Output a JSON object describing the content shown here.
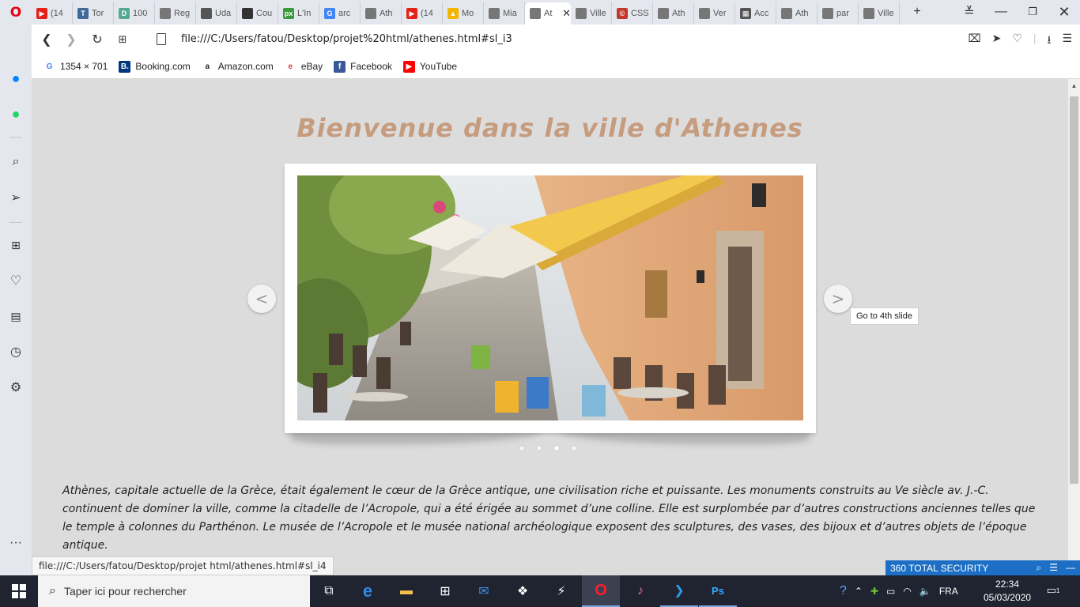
{
  "browser": {
    "tabs": [
      {
        "label": "(14",
        "favicon_color": "#e62117",
        "glyph": "▶"
      },
      {
        "label": "Tor",
        "favicon_color": "#3d6a96",
        "glyph": "T"
      },
      {
        "label": "100",
        "favicon_color": "#54a992",
        "glyph": "D"
      },
      {
        "label": "Reg",
        "favicon_color": "#777777",
        "glyph": ""
      },
      {
        "label": "Uda",
        "favicon_color": "#555555",
        "glyph": ""
      },
      {
        "label": "Cou",
        "favicon_color": "#333333",
        "glyph": ""
      },
      {
        "label": "L'In",
        "favicon_color": "#3a9a3a",
        "glyph": "px"
      },
      {
        "label": "arc",
        "favicon_color": "#4285f4",
        "glyph": "G"
      },
      {
        "label": "Ath",
        "favicon_color": "#777777",
        "glyph": ""
      },
      {
        "label": "(14",
        "favicon_color": "#e62117",
        "glyph": "▶"
      },
      {
        "label": "Mo",
        "favicon_color": "#f4b400",
        "glyph": "▲"
      },
      {
        "label": "Mia",
        "favicon_color": "#777777",
        "glyph": ""
      },
      {
        "label": "At",
        "favicon_color": "#777777",
        "glyph": "",
        "active": true
      },
      {
        "label": "Ville",
        "favicon_color": "#777777",
        "glyph": ""
      },
      {
        "label": "CSS",
        "favicon_color": "#c0392b",
        "glyph": "©"
      },
      {
        "label": "Ath",
        "favicon_color": "#777777",
        "glyph": ""
      },
      {
        "label": "Ver",
        "favicon_color": "#777777",
        "glyph": ""
      },
      {
        "label": "Acc",
        "favicon_color": "#555555",
        "glyph": "▦"
      },
      {
        "label": "Ath",
        "favicon_color": "#777777",
        "glyph": ""
      },
      {
        "label": "par",
        "favicon_color": "#777777",
        "glyph": ""
      },
      {
        "label": "Ville",
        "favicon_color": "#777777",
        "glyph": ""
      }
    ],
    "new_tab": "+",
    "url": "file:///C:/Users/fatou/Desktop/projet%20html/athenes.html#sl_i3",
    "bookmarks": [
      {
        "label": "1354 × 701",
        "icon": "G",
        "color": "#4285f4",
        "bg": "#ffffff"
      },
      {
        "label": "Booking.com",
        "icon": "B.",
        "color": "#ffffff",
        "bg": "#003580"
      },
      {
        "label": "Amazon.com",
        "icon": "a",
        "color": "#222222",
        "bg": "#ffffff"
      },
      {
        "label": "eBay",
        "icon": "e",
        "color": "#e53238",
        "bg": "#ffffff"
      },
      {
        "label": "Facebook",
        "icon": "f",
        "color": "#ffffff",
        "bg": "#3b5998"
      },
      {
        "label": "YouTube",
        "icon": "▶",
        "color": "#ffffff",
        "bg": "#ff0000"
      }
    ]
  },
  "page": {
    "title": "Bienvenue dans la ville d'Athenes",
    "prev_arrow": "<",
    "next_arrow": ">",
    "tooltip": "Go to 4th slide",
    "slides_count": 4,
    "active_slide": 3,
    "intro": "Athènes, capitale actuelle de la Grèce, était également le cœur de la Grèce antique, une civilisation riche et puissante. Les monuments construits au Ve siècle av. J.-C. continuent de dominer la ville, comme la citadelle de l’Acropole, qui a été érigée au sommet d’une colline. Elle est surplombée par d’autres constructions anciennes telles que le temple à colonnes du Parthénon. Le musée de l’Acropole et le musée national archéologique exposent des sculptures, des vases, des bijoux et d’autres objets de l’époque antique."
  },
  "status_link": "file:///C:/Users/fatou/Desktop/projet html/athenes.html#sl_i4",
  "security_bar": {
    "label": "360 TOTAL SECURITY"
  },
  "taskbar": {
    "search_placeholder": "Taper ici pour rechercher",
    "language": "FRA",
    "time": "22:34",
    "date": "05/03/2020",
    "notification_count": "1"
  }
}
